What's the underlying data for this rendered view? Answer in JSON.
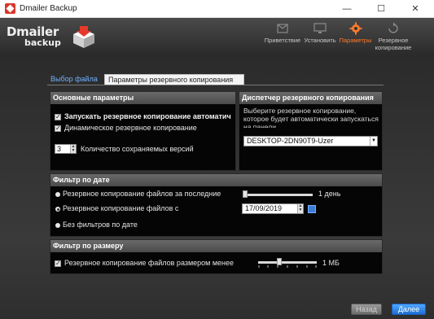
{
  "window": {
    "title": "Dmailer Backup",
    "min_icon": "minimize-icon",
    "max_icon": "maximize-icon",
    "close_icon": "close-icon"
  },
  "logo": {
    "line1": "Dmailer",
    "line2": "backup"
  },
  "nav": [
    {
      "label": "Приветствие",
      "icon": "welcome-icon",
      "active": false
    },
    {
      "label": "Установить",
      "icon": "monitor-icon",
      "active": false
    },
    {
      "label": "Параметры",
      "icon": "gear-icon",
      "active": true
    },
    {
      "label": "Резервное копирование",
      "icon": "backup-icon",
      "active": false
    }
  ],
  "tabs": {
    "file_selection": "Выбор файла",
    "backup_settings": "Параметры резервного копирования"
  },
  "basic": {
    "title": "Основные параметры",
    "auto_backup": {
      "label": "Запускать резервное копирование автоматич",
      "checked": true
    },
    "dynamic_backup": {
      "label": "Динамическое резервное копирование",
      "checked": true
    },
    "versions": {
      "value": "3",
      "label": "Количество сохраняемых версий"
    }
  },
  "manager": {
    "title": "Диспетчер резервного копирования",
    "description": "Выберите резервное копирование, которое будет автоматически запускаться на панели",
    "selected": "DESKTOP-2DN90T9-Uzer"
  },
  "date_filter": {
    "title": "Фильтр по дате",
    "option_last": {
      "label": "Резервное копирование файлов за последние",
      "value_label": "1 день",
      "level": 0,
      "selected": false
    },
    "option_since": {
      "label": "Резервное копирование файлов с",
      "date": "17/09/2019",
      "selected": true
    },
    "option_none": {
      "label": "Без фильтров по дате",
      "selected": false
    }
  },
  "size_filter": {
    "title": "Фильтр по размеру",
    "option": {
      "label": "Резервное копирование файлов размером менее",
      "value_label": "1 МБ",
      "level": 0.35,
      "checked": true
    }
  },
  "footer": {
    "back_label": "Назад",
    "next_label": "Далее"
  },
  "colors": {
    "accent": "#ff7a2a",
    "link_blue": "#6fb1ff",
    "next_button": "#2f86e6"
  }
}
